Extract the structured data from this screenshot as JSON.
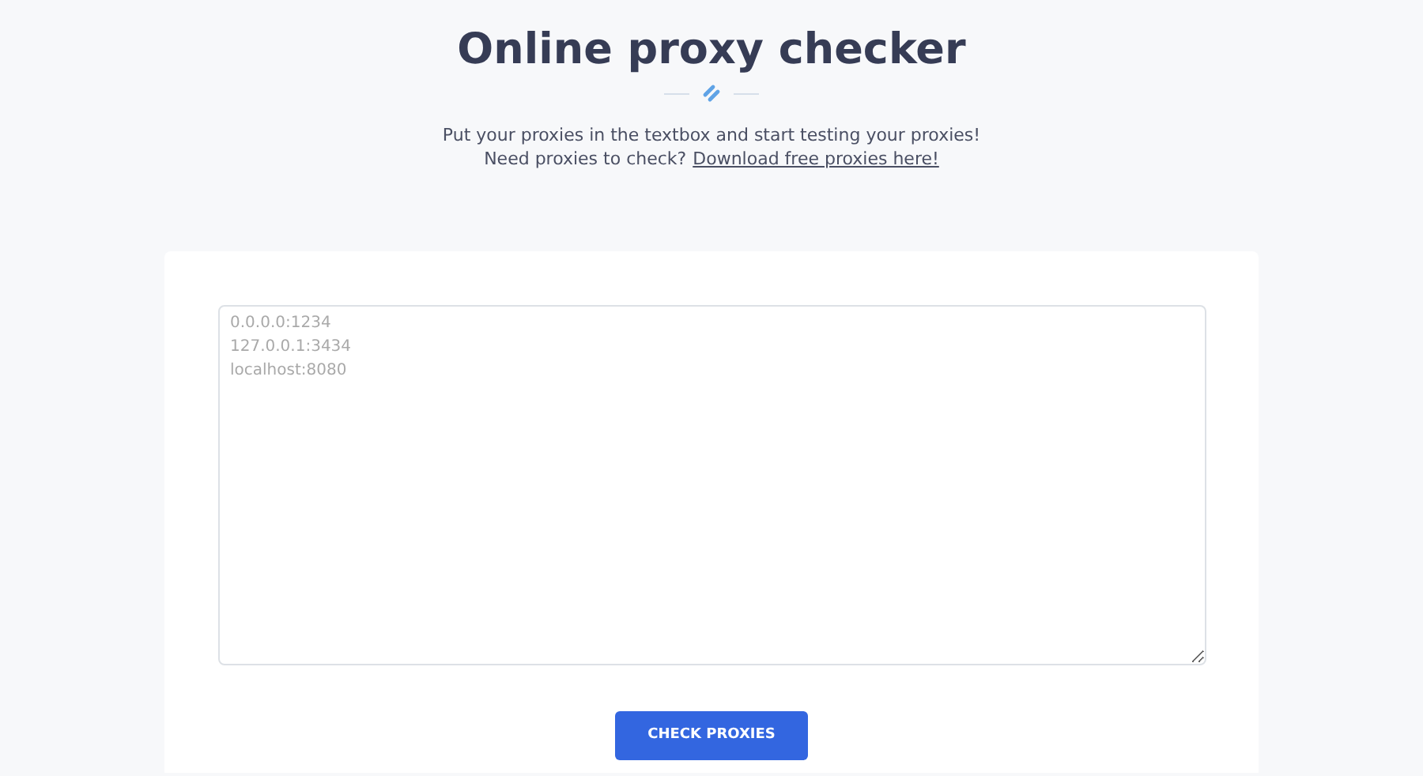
{
  "title": "Online proxy checker",
  "intro": "Put your proxies in the textbox and start testing your proxies!",
  "prompt": "Need proxies to check?",
  "link": "Download free proxies here!",
  "textbox": {
    "placeholder": "0.0.0.0:1234\n127.0.0.1:3434\nlocalhost:8080"
  },
  "button": "CHECK PROXIES"
}
